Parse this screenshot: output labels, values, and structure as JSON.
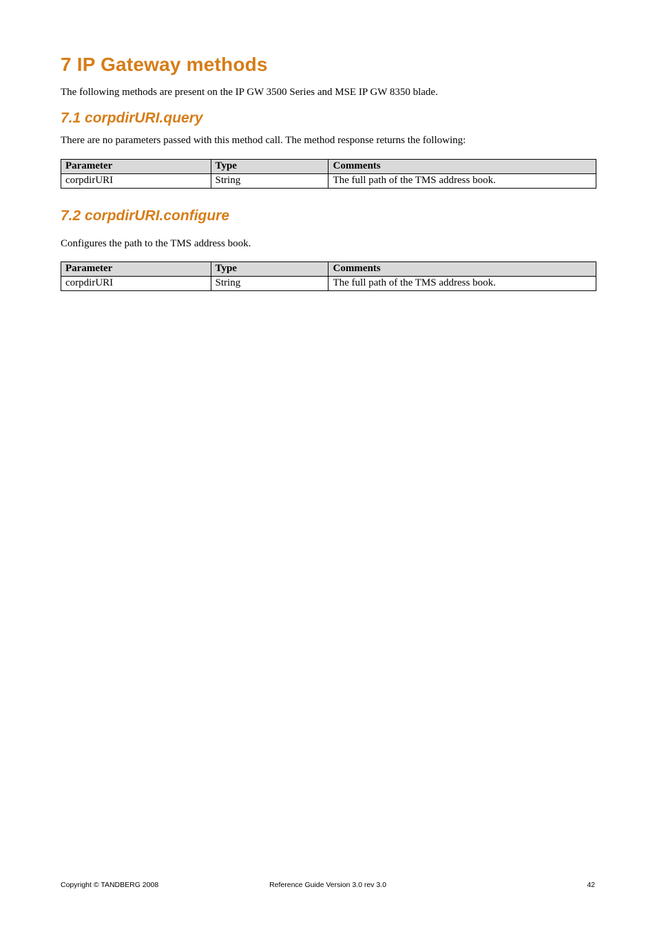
{
  "heading": "7  IP Gateway methods",
  "intro": "The following methods are present on the IP GW 3500 Series and MSE IP GW 8350 blade.",
  "sections": [
    {
      "title": "7.1  corpdirURI.query",
      "lead": "There are no parameters passed with this method call. The method response returns the following:",
      "table": {
        "headers": {
          "param": "Parameter",
          "type": "Type",
          "comments": "Comments"
        },
        "rows": [
          {
            "param": "corpdirURI",
            "type": "String",
            "comments": "The full path of the TMS address book."
          }
        ]
      }
    },
    {
      "title": "7.2  corpdirURI.configure",
      "lead": "Configures the path to the TMS address book.",
      "table": {
        "headers": {
          "param": "Parameter",
          "type": "Type",
          "comments": "Comments"
        },
        "rows": [
          {
            "param": "corpdirURI",
            "type": "String",
            "comments": "The full path of the TMS address book."
          }
        ]
      }
    }
  ],
  "footer": {
    "left": "Copyright © TANDBERG 2008",
    "center": "Reference Guide Version 3.0 rev 3.0",
    "right": "42"
  }
}
